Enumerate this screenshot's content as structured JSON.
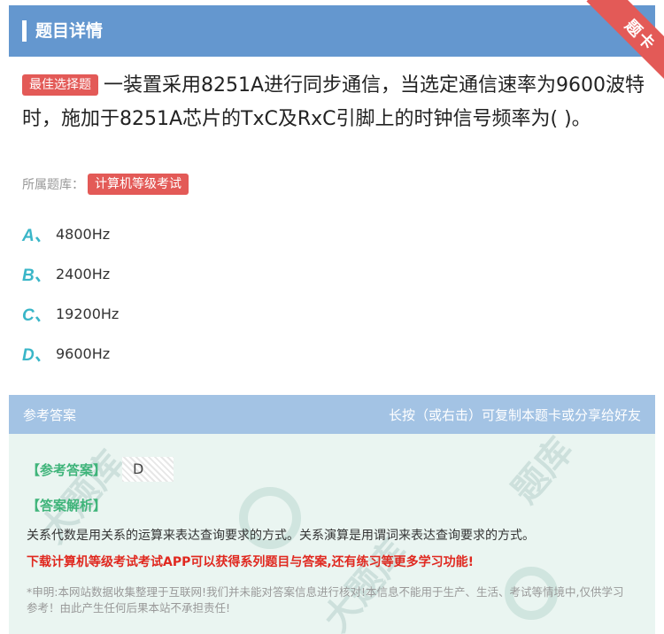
{
  "header": {
    "title": "题目详情",
    "ribbon_label": "题卡",
    "background_color": "#6497cf",
    "ribbon_color": "#e35a57"
  },
  "question": {
    "type_tag": "最佳选择题",
    "text": "一装置采用8251A进行同步通信，当选定通信速率为9600波特时，施加于8251A芯片的TxC及RxC引脚上的时钟信号频率为( )。",
    "source_label": "所属题库：",
    "source_tag": "计算机等级考试"
  },
  "options": [
    {
      "letter": "A、",
      "text": "4800Hz"
    },
    {
      "letter": "B、",
      "text": "2400Hz"
    },
    {
      "letter": "C、",
      "text": "19200Hz"
    },
    {
      "letter": "D、",
      "text": "9600Hz"
    }
  ],
  "answer_section": {
    "header_left": "参考答案",
    "header_right": "长按（或右击）可复制本题卡或分享给好友",
    "answer_label": "【参考答案】",
    "answer_value": "D",
    "analysis_label": "【答案解析】",
    "analysis_text": "关系代数是用关系的运算来表达查询要求的方式。关系演算是用谓词来表达查询要求的方式。",
    "promo_text": "下载计算机等级考试考试APP可以获得系列题目与答案,还有练习等更多学习功能!",
    "disclaimer": "*申明:本网站数据收集整理于互联网!我们并未能对答案信息进行核对!本信息不能用于生产、生活、考试等情境中,仅供学习参考！由此产生任何后果本站不承担责任!",
    "accent_color": "#3fb47a",
    "promo_color": "#e0281f"
  }
}
